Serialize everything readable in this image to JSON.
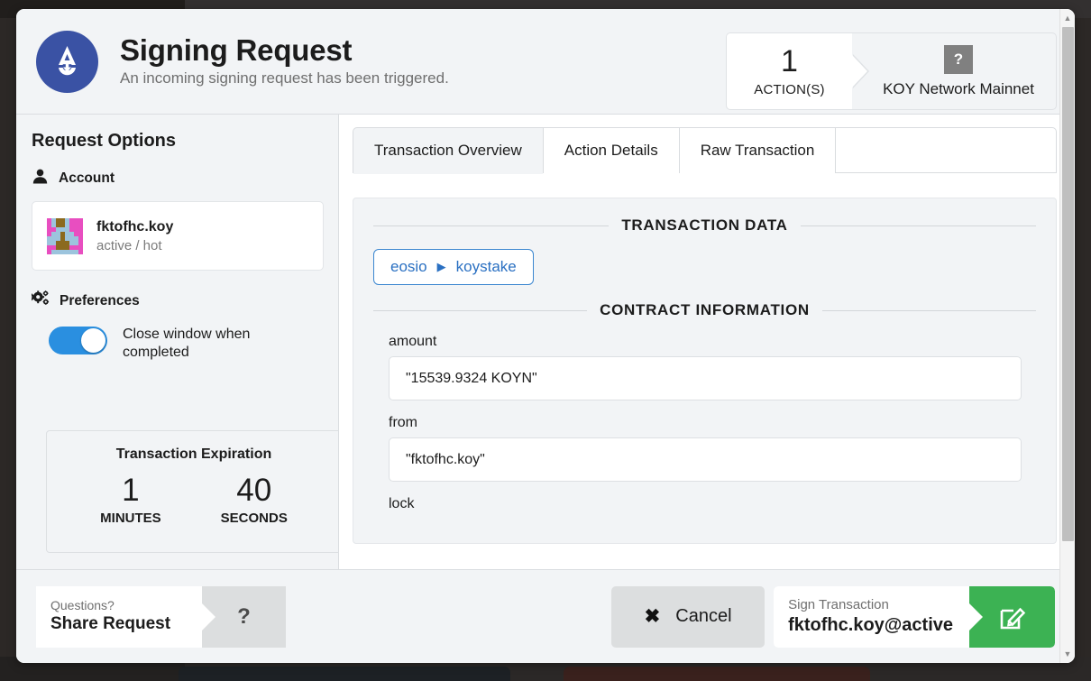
{
  "header": {
    "logo_icon": "anchor-a-logo-icon",
    "title": "Signing Request",
    "subtitle": "An incoming signing request has been triggered.",
    "badge_actions": {
      "count": "1",
      "label": "ACTION(S)"
    },
    "badge_network": {
      "icon": "?",
      "name": "KOY Network Mainnet"
    }
  },
  "sidebar": {
    "title": "Request Options",
    "account_section": {
      "icon": "person-icon",
      "label": "Account",
      "account_name": "fktofhc.koy",
      "permission": "active / hot",
      "identicon_colors": [
        "#e84ec0",
        "#9cc4dd",
        "#8b6a1e"
      ]
    },
    "preferences_section": {
      "icon": "gears-icon",
      "label": "Preferences",
      "toggle_label": "Close window when completed",
      "toggle_on": true,
      "toggle_color": "#2a8fe0"
    },
    "expiration": {
      "title": "Transaction Expiration",
      "minutes_value": "1",
      "minutes_label": "MINUTES",
      "seconds_value": "40",
      "seconds_label": "SECONDS"
    }
  },
  "main": {
    "tabs": [
      {
        "label": "Transaction Overview",
        "active": true
      },
      {
        "label": "Action Details",
        "active": false
      },
      {
        "label": "Raw Transaction",
        "active": false
      }
    ],
    "transaction_data_heading": "TRANSACTION DATA",
    "action_chip": {
      "contract": "eosio",
      "arrow": "▶",
      "action": "koystake",
      "color": "#2a70c2"
    },
    "contract_information_heading": "CONTRACT INFORMATION",
    "fields": [
      {
        "label": "amount",
        "value": "\"15539.9324 KOYN\""
      },
      {
        "label": "from",
        "value": "\"fktofhc.koy\""
      },
      {
        "label": "lock",
        "value": ""
      }
    ]
  },
  "footer": {
    "share": {
      "question_label": "Questions?",
      "action_label": "Share Request",
      "icon": "?"
    },
    "cancel": {
      "icon": "✖",
      "label": "Cancel"
    },
    "sign": {
      "sub_label": "Sign Transaction",
      "account_label": "fktofhc.koy@active",
      "icon": "pencil-square-icon",
      "color": "#3cb253"
    }
  },
  "scrollbar": {
    "up_arrow": "▲",
    "down_arrow": "▼"
  }
}
